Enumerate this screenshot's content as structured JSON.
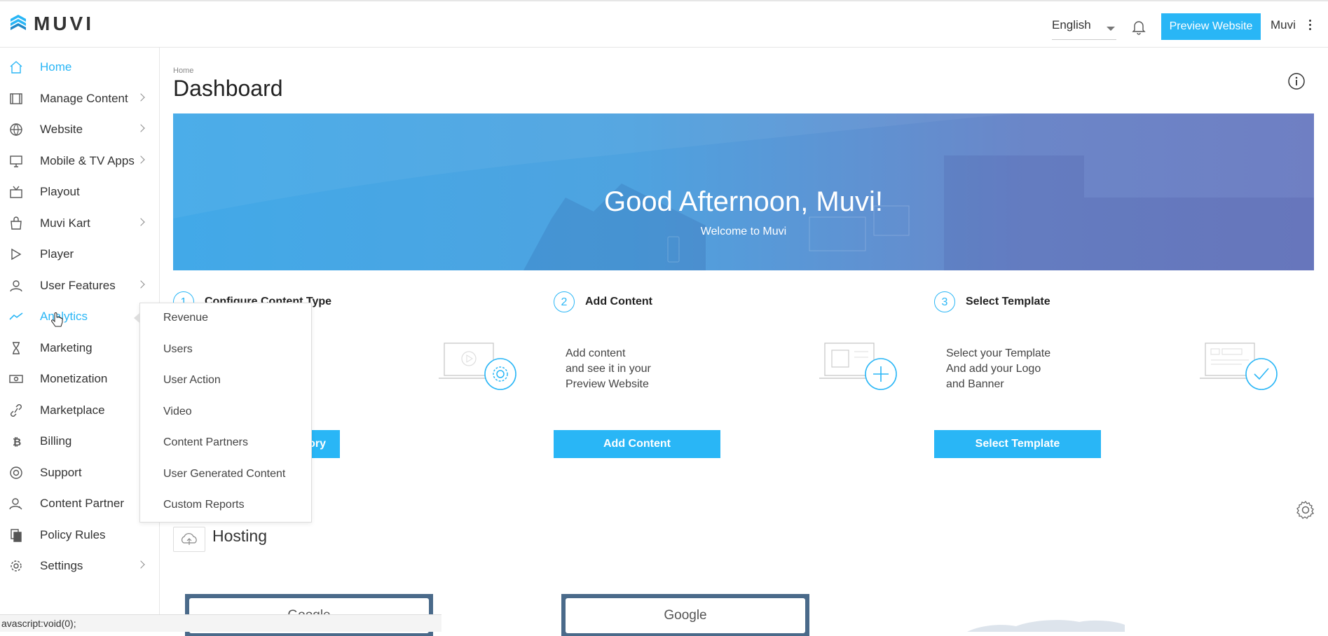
{
  "brand": {
    "name": "MUVI"
  },
  "header": {
    "language": "English",
    "preview_label": "Preview Website",
    "user_name": "Muvi"
  },
  "sidebar": {
    "items": [
      {
        "label": "Home"
      },
      {
        "label": "Manage Content"
      },
      {
        "label": "Website"
      },
      {
        "label": "Mobile & TV Apps"
      },
      {
        "label": "Playout"
      },
      {
        "label": "Muvi Kart"
      },
      {
        "label": "Player"
      },
      {
        "label": "User Features"
      },
      {
        "label": "Analytics"
      },
      {
        "label": "Marketing"
      },
      {
        "label": "Monetization"
      },
      {
        "label": "Marketplace"
      },
      {
        "label": "Billing"
      },
      {
        "label": "Support"
      },
      {
        "label": "Content Partner"
      },
      {
        "label": "Policy Rules"
      },
      {
        "label": "Settings"
      }
    ]
  },
  "analytics_menu": {
    "items": [
      "Revenue",
      "Users",
      "User Action",
      "Video",
      "Content Partners",
      "User Generated Content",
      "Custom Reports"
    ]
  },
  "main": {
    "breadcrumb": "Home",
    "title": "Dashboard",
    "banner": {
      "greeting": "Good Afternoon, Muvi!",
      "subtitle": "Welcome to Muvi"
    },
    "steps": [
      {
        "num": "1",
        "title": "Configure Content Type",
        "button": "ory"
      },
      {
        "num": "2",
        "title": "Add Content",
        "desc": [
          "Add content",
          "and see it in your",
          "Preview Website"
        ],
        "button": "Add Content"
      },
      {
        "num": "3",
        "title": "Select Template",
        "desc": [
          "Select your Template",
          "And add your Logo",
          "and Banner"
        ],
        "button": "Select Template"
      }
    ],
    "hosting_title": "Hosting",
    "map_label": "Google"
  },
  "status_bar": "avascript:void(0);",
  "colors": {
    "accent": "#29b6f6",
    "banner_start": "#42a9e8",
    "banner_end": "#6f7fc3"
  }
}
